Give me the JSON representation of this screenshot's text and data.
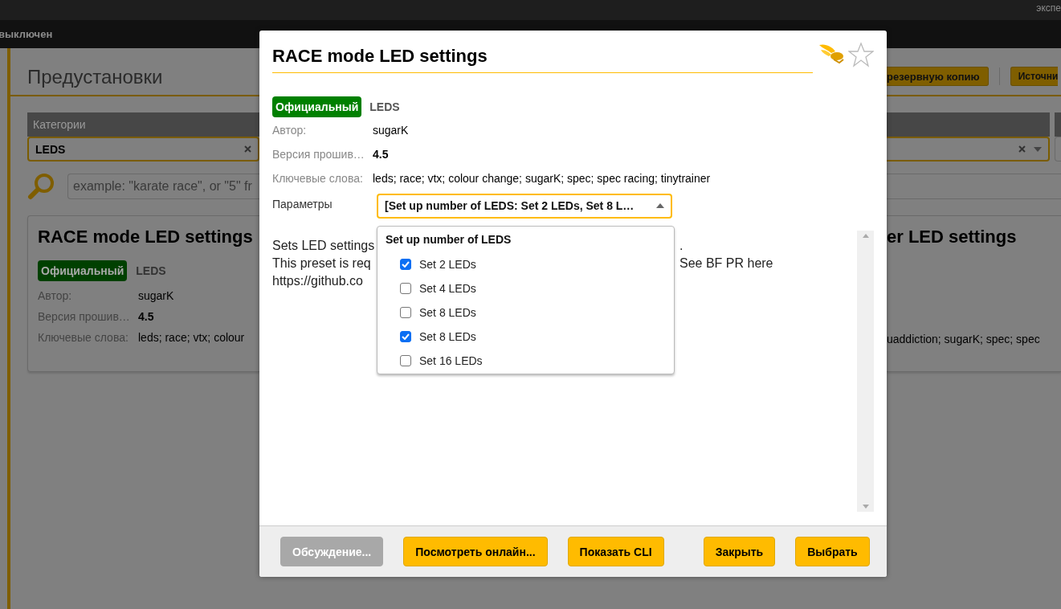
{
  "top_bar": {
    "text": "экспе"
  },
  "status_bar": {
    "text": "выключен"
  },
  "page": {
    "title": "Предустановки",
    "buttons": [
      {
        "label": "резервную копию"
      },
      {
        "label": "Источни"
      }
    ],
    "category_filter": {
      "header": "Категории",
      "value": "LEDS"
    },
    "search": {
      "placeholder": "example: \"karate race\", or \"5\" fr"
    },
    "cards": [
      {
        "title": "RACE mode LED settings",
        "badge": "Официальный",
        "category": "LEDS",
        "author": {
          "label": "Автор:",
          "value": "sugarK"
        },
        "firmware": {
          "label": "Версия прошив…",
          "value": "4.5"
        },
        "keywords": {
          "label": "Ключевые слова:",
          "value": "leds; race; vtx; colour"
        }
      },
      {
        "title": "er LED settings",
        "keywords": "uaddiction; sugarK; spec; spec"
      }
    ]
  },
  "dialog": {
    "title": "RACE mode LED settings",
    "favorite": false,
    "badge": "Официальный",
    "category": "LEDS",
    "author": {
      "label": "Автор:",
      "value": "sugarK"
    },
    "firmware": {
      "label": "Версия прошив…",
      "value": "4.5"
    },
    "keywords": {
      "label": "Ключевые слова:",
      "value": "leds; race; vtx; colour change; sugarK; spec; spec racing; tinytrainer"
    },
    "parameters": {
      "label": "Параметры",
      "value": "[Set up number of LEDS: Set 2 LEDs, Set 8 L…",
      "expanded": true
    },
    "dropdown": {
      "header": "Set up number of LEDS",
      "options": [
        {
          "label": "Set 2 LEDs",
          "checked": true
        },
        {
          "label": "Set 4 LEDs",
          "checked": false
        },
        {
          "label": "Set 8 LEDs",
          "checked": false
        },
        {
          "label": "Set 8 LEDs",
          "checked": true
        },
        {
          "label": "Set 16 LEDs",
          "checked": false
        }
      ]
    },
    "description": [
      {
        "left": "Sets LED settings",
        "right": "."
      },
      {
        "left": "This preset is req",
        "right": "See BF PR here"
      },
      {
        "left": "https://github.co"
      }
    ],
    "buttons": [
      {
        "label": "Обсуждение...",
        "disabled": true
      },
      {
        "label": "Посмотреть онлайн...",
        "disabled": false
      },
      {
        "label": "Показать CLI",
        "disabled": false
      },
      {
        "label": "Закрыть",
        "disabled": false
      },
      {
        "label": "Выбрать",
        "disabled": false
      }
    ]
  }
}
